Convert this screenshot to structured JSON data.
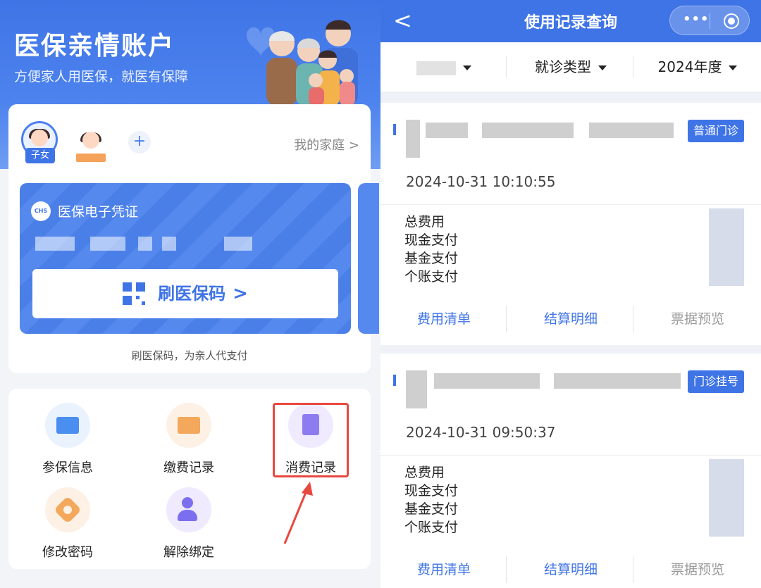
{
  "left": {
    "title": "医保亲情账户",
    "subtitle": "方便家人用医保，就医有保障",
    "member_tag": "子女",
    "my_family": "我的家庭 >",
    "voucher": {
      "logo": "CHS",
      "title": "医保电子凭证",
      "scan_label": "刷医保码",
      "scan_chevron": ">",
      "caption": "刷医保码，为亲人代支付"
    },
    "menu": [
      {
        "label": "参保信息",
        "icon": "insurance-card-icon"
      },
      {
        "label": "缴费记录",
        "icon": "payment-record-icon"
      },
      {
        "label": "消费记录",
        "icon": "consumption-record-icon"
      },
      {
        "label": "修改密码",
        "icon": "password-gear-icon"
      },
      {
        "label": "解除绑定",
        "icon": "unbind-user-icon"
      }
    ]
  },
  "right": {
    "nav_title": "使用记录查询",
    "filters": {
      "type": "就诊类型",
      "year": "2024年度"
    },
    "records": [
      {
        "badge": "普通门诊",
        "time": "2024-10-31 10:10:55",
        "labels": [
          "总费用",
          "现金支付",
          "基金支付",
          "个账支付"
        ],
        "actions": [
          "费用清单",
          "结算明细",
          "票据预览"
        ]
      },
      {
        "badge": "门诊挂号",
        "time": "2024-10-31 09:50:37",
        "labels": [
          "总费用",
          "现金支付",
          "基金支付",
          "个账支付"
        ],
        "actions": [
          "费用清单",
          "结算明细",
          "票据预览"
        ]
      }
    ]
  },
  "colors": {
    "primary": "#3f74e6",
    "highlight": "#e8483f"
  }
}
